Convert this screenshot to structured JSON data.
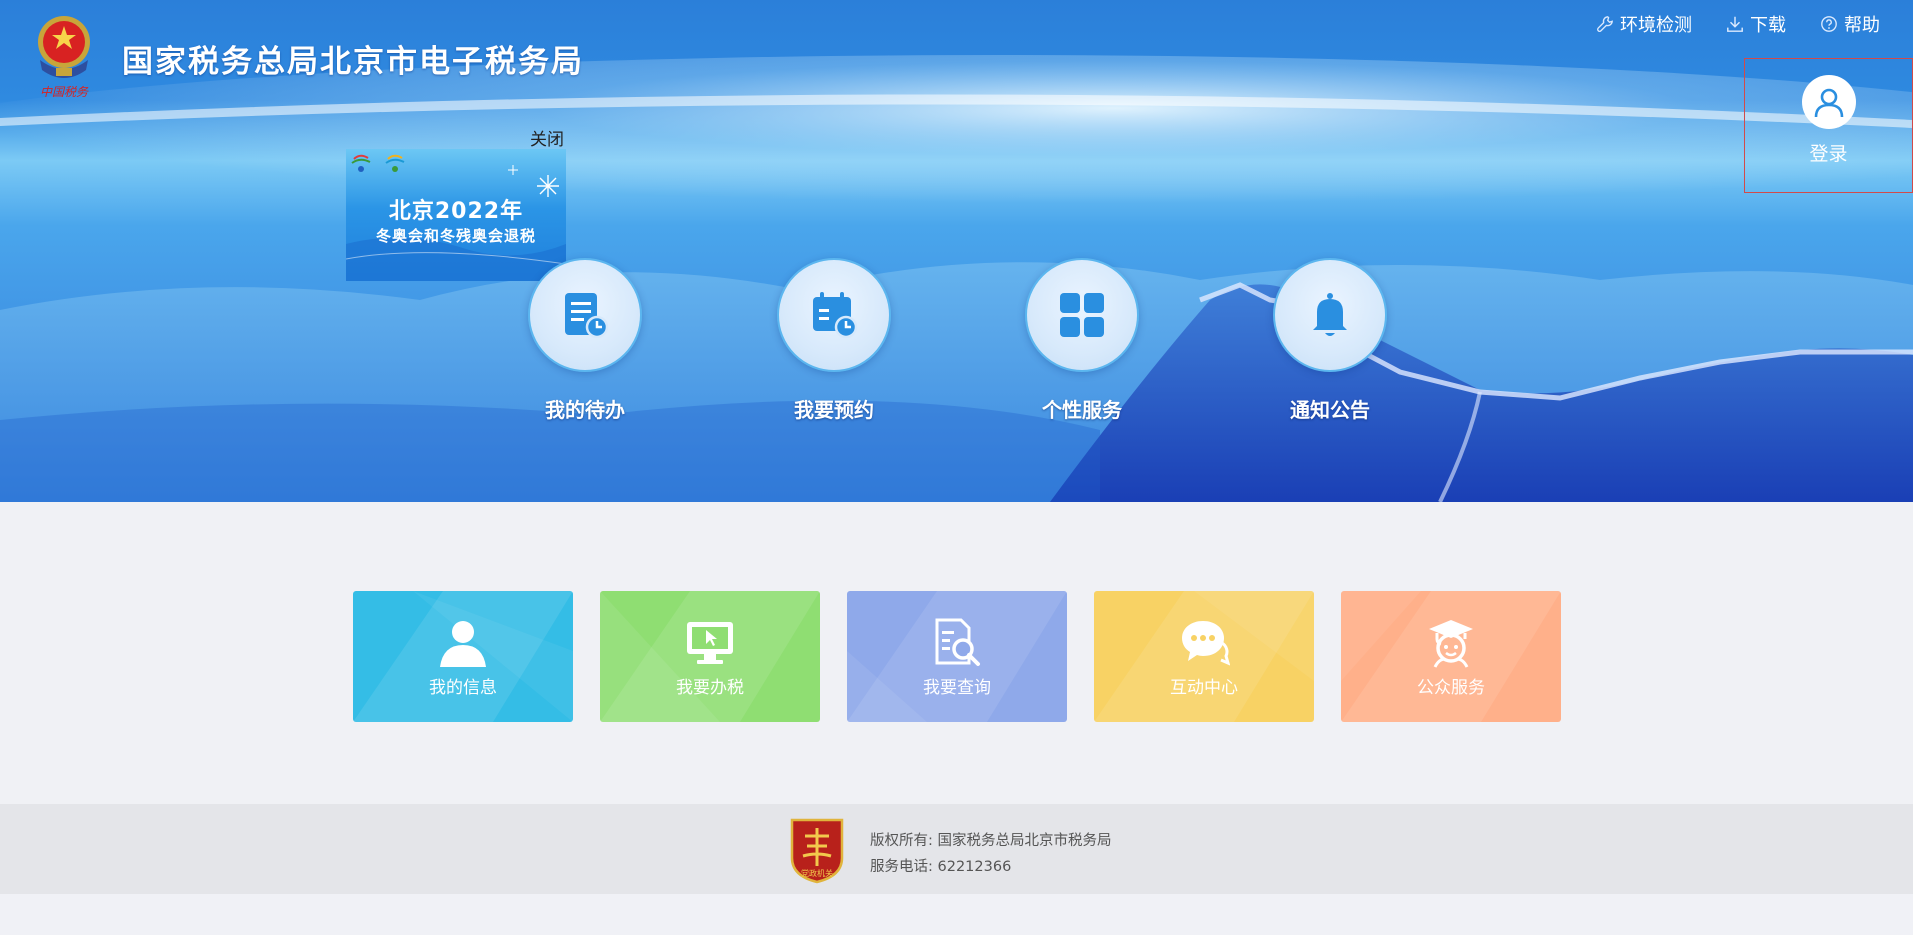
{
  "header": {
    "site_title": "国家税务总局北京市电子税务局",
    "emblem_caption": "中国税务"
  },
  "toplinks": [
    {
      "label": "环境检测",
      "icon": "wrench-icon"
    },
    {
      "label": "下载",
      "icon": "download-icon"
    },
    {
      "label": "帮助",
      "icon": "help-icon"
    }
  ],
  "login": {
    "label": "登录",
    "icon": "user-avatar-icon"
  },
  "ad": {
    "close_label": "关闭",
    "line1": "北京2022年",
    "line2": "冬奥会和冬残奥会退税"
  },
  "circle_nav": [
    {
      "label": "我的待办",
      "icon": "todo-list-icon"
    },
    {
      "label": "我要预约",
      "icon": "calendar-clock-icon"
    },
    {
      "label": "个性服务",
      "icon": "grid-icon"
    },
    {
      "label": "通知公告",
      "icon": "bell-icon"
    }
  ],
  "tiles": [
    {
      "label": "我的信息",
      "icon": "person-icon",
      "color": "#34bde6"
    },
    {
      "label": "我要办税",
      "icon": "monitor-cursor-icon",
      "color": "#8fde72"
    },
    {
      "label": "我要查询",
      "icon": "document-search-icon",
      "color": "#8fa9ea"
    },
    {
      "label": "互动中心",
      "icon": "chat-bubbles-icon",
      "color": "#f8d264"
    },
    {
      "label": "公众服务",
      "icon": "graduate-icon",
      "color": "#ffb08a"
    }
  ],
  "footer": {
    "copyright": "版权所有: 国家税务总局北京市税务局",
    "phone": "服务电话: 62212366",
    "badge_text": "党政机关"
  },
  "colors": {
    "hero_blue": "#2d7fd6",
    "circle_border": "#5bb6ef",
    "icon_blue": "#2a8fe0",
    "login_border": "#d24a4a",
    "footer_bg": "#e4e5e9"
  }
}
